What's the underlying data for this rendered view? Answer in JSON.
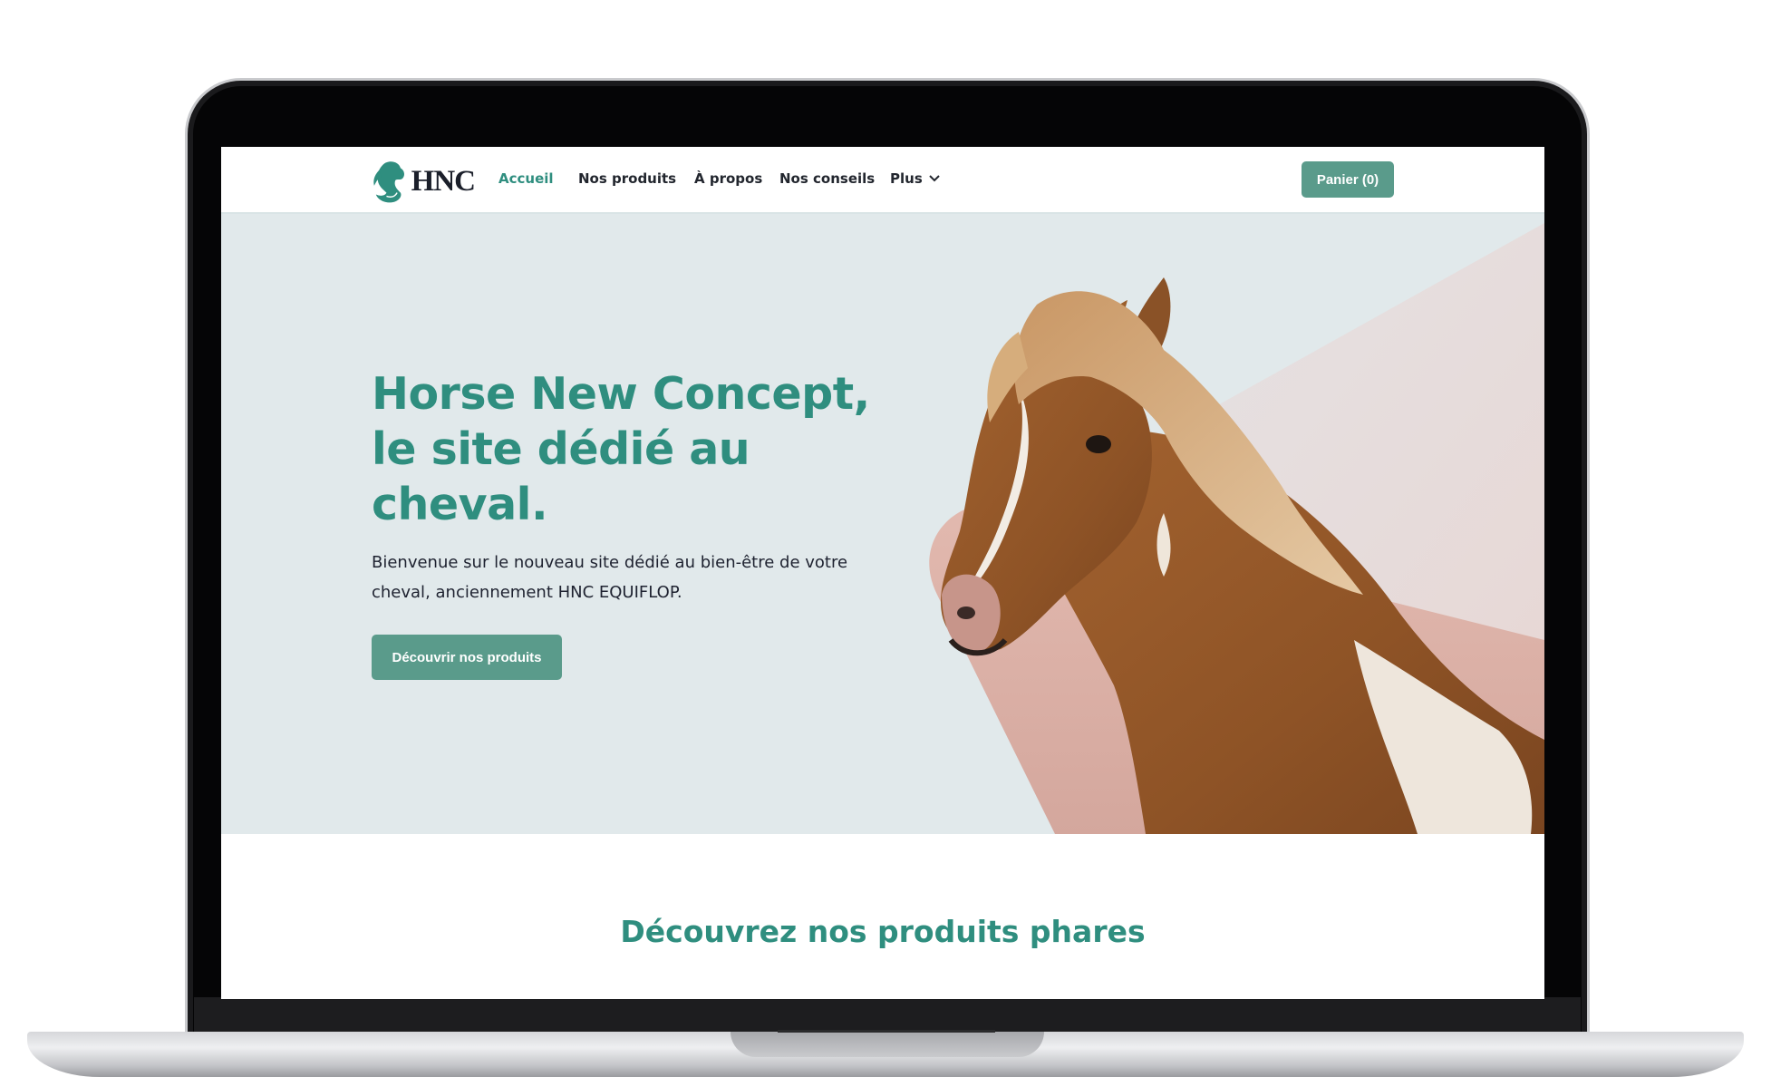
{
  "logo": {
    "text": "HNC"
  },
  "nav": {
    "items": [
      {
        "label": "Accueil",
        "active": true
      },
      {
        "label": "Nos produits"
      },
      {
        "label": "À propos"
      },
      {
        "label": "Nos conseils"
      },
      {
        "label": "Plus"
      }
    ],
    "cart_label": "Panier (0)"
  },
  "hero": {
    "title": "Horse New Concept, le site dédié au cheval.",
    "text": "Bienvenue sur le nouveau site dédié au bien-être de votre cheval, anciennement HNC EQUIFLOP.",
    "cta_label": "Découvrir nos produits",
    "image": "horse-portrait"
  },
  "featured": {
    "title": "Découvrez nos produits phares"
  },
  "colors": {
    "accent": "#2f8e7f",
    "button": "#5a9b8b",
    "hero_bg": "#e1e9eb",
    "shape_pink": "#d8aca2"
  }
}
